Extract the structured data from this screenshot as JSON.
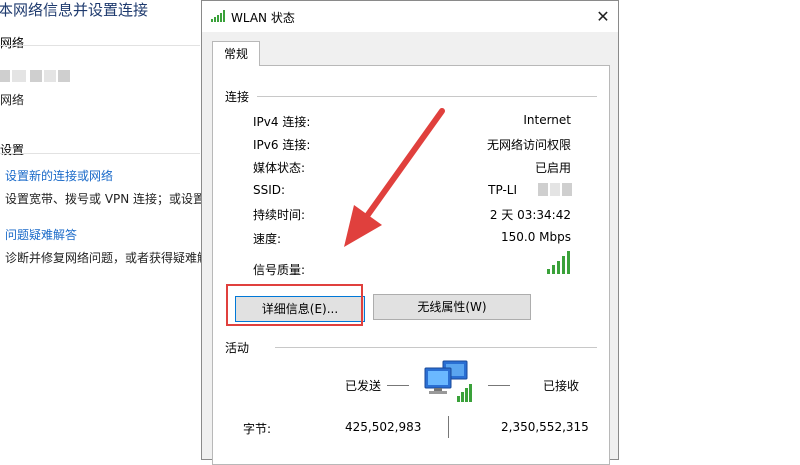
{
  "background": {
    "title": "本网络信息并设置连接",
    "section_network": "网络",
    "network_label_fragment": "网络",
    "section_settings": "设置",
    "link_new_connection": "设置新的连接或网络",
    "text_new_connection": "设置宽带、拨号或 VPN 连接；或设置",
    "link_troubleshoot": "问题疑难解答",
    "text_troubleshoot": "诊断并修复网络问题，或者获得疑难解"
  },
  "dialog": {
    "title": "WLAN 状态",
    "close": "✕",
    "tab_general": "常规",
    "connection_section": "连接",
    "rows": [
      {
        "label": "IPv4 连接:",
        "value": "Internet"
      },
      {
        "label": "IPv6 连接:",
        "value": "无网络访问权限"
      },
      {
        "label": "媒体状态:",
        "value": "已启用"
      },
      {
        "label": "SSID:",
        "value": "TP-LI"
      },
      {
        "label": "持续时间:",
        "value": "2 天 03:34:42"
      },
      {
        "label": "速度:",
        "value": "150.0 Mbps"
      }
    ],
    "signal_label": "信号质量:",
    "signal_bars": 5,
    "details_button": "详细信息(E)...",
    "wireless_button": "无线属性(W)",
    "activity_section": "活动",
    "sent_label": "已发送",
    "received_label": "已接收",
    "bytes_label": "字节:",
    "bytes_sent": "425,502,983",
    "bytes_received": "2,350,552,315"
  },
  "colors": {
    "accent_link": "#1a6ac9",
    "highlight_red": "#e0403d",
    "signal_green": "#3aa13a"
  }
}
